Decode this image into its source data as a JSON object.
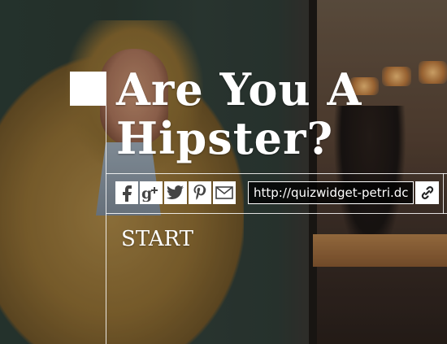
{
  "quiz": {
    "title": "Are You A Hipster?",
    "start_label": "START"
  },
  "share": {
    "url_value": "http://quizwidget-petri.dc",
    "buttons": [
      "facebook-icon",
      "google-plus-icon",
      "twitter-icon",
      "pinterest-icon",
      "email-icon"
    ],
    "link_icon": "link-icon"
  },
  "colors": {
    "overlay_text": "#ffffff",
    "url_field_bg": "#000000"
  }
}
